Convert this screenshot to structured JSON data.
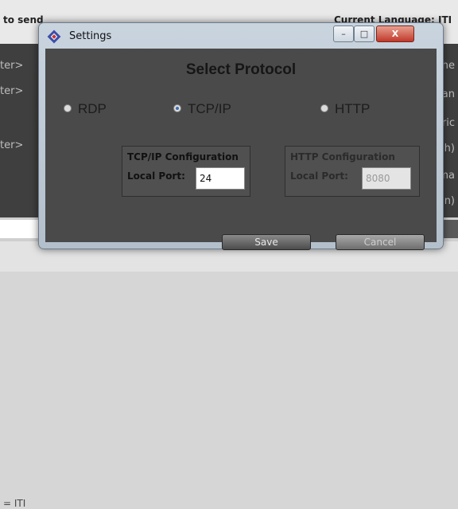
{
  "background_app": {
    "top_left_text": "to send",
    "top_right_text": "Current Language: ITI",
    "left_lines": [
      "ter>",
      "ter>",
      "ter>"
    ],
    "right_lines": [
      "the",
      "lan",
      "eric",
      "ch)",
      "ma",
      "n)"
    ],
    "bottom_text": "= ITI"
  },
  "dialog": {
    "title": "Settings",
    "controls": {
      "minimize": "–",
      "maximize": "□",
      "close": "X"
    },
    "heading": "Select Protocol",
    "protocols": [
      {
        "label": "RDP",
        "selected": false
      },
      {
        "label": "TCP/IP",
        "selected": true
      },
      {
        "label": "HTTP",
        "selected": false
      }
    ],
    "tcp_config": {
      "title": "TCP/IP Configuration",
      "port_label": "Local Port:",
      "port_value": "24",
      "enabled": true
    },
    "http_config": {
      "title": "HTTP Configuration",
      "port_label": "Local Port:",
      "port_value": "8080",
      "enabled": false
    },
    "buttons": {
      "save": "Save",
      "cancel": "Cancel"
    }
  },
  "colors": {
    "accent": "#3c6fb3",
    "close_button": "#c0392b",
    "client_bg": "#4a4a4a"
  }
}
